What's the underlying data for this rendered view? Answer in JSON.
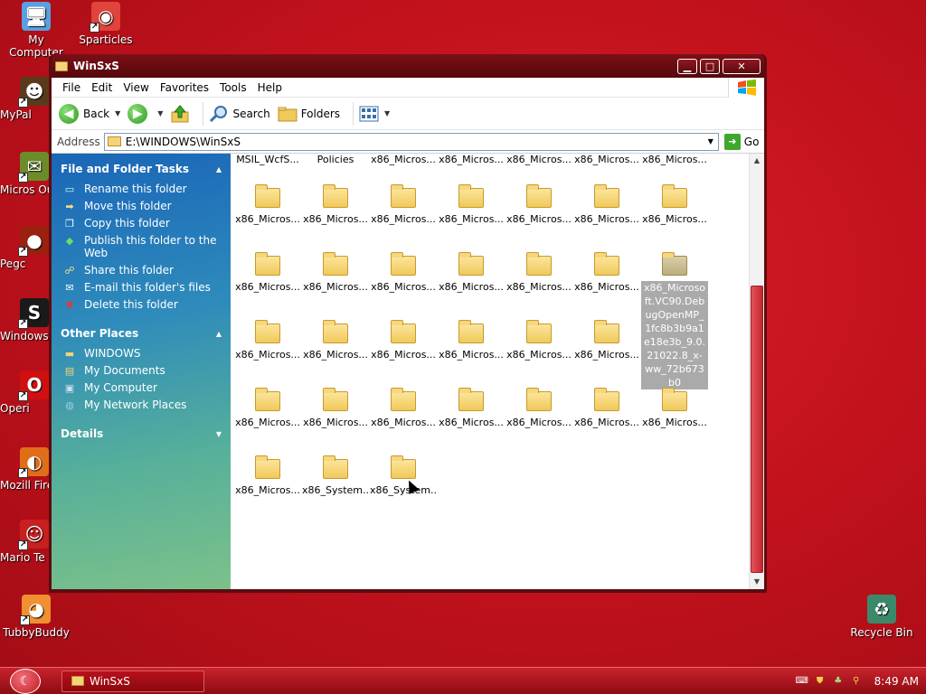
{
  "desktop": {
    "icons": [
      {
        "label": "My Computer",
        "glyph": "computer-icon",
        "color": "#5aa0e0"
      },
      {
        "label": "Sparticles",
        "glyph": "chrome-icon",
        "color": "#e0443a"
      },
      {
        "label": "MyPal",
        "glyph": "mypal-icon",
        "color": "#5b3a1c"
      },
      {
        "label": "Micros Outloo",
        "glyph": "outlook-icon",
        "color": "#6c8c2a"
      },
      {
        "label": "Pegc",
        "glyph": "pegasus-icon",
        "color": "#9a2010"
      },
      {
        "label": "Windows",
        "glyph": "windows-s-icon",
        "color": "#1a1a1a"
      },
      {
        "label": "Operi",
        "glyph": "opera-icon",
        "color": "#d01010"
      },
      {
        "label": "Mozill Firefo",
        "glyph": "firefox-icon",
        "color": "#e06e18"
      },
      {
        "label": "Mario Te",
        "glyph": "mario-icon",
        "color": "#c82020"
      },
      {
        "label": "TubbyBuddy",
        "glyph": "tubbybuddy-icon",
        "color": "#f09030"
      },
      {
        "label": "Recycle Bin",
        "glyph": "recycle-bin-icon",
        "color": "#3a8a6a"
      }
    ]
  },
  "window": {
    "title": "WinSxS",
    "controls": {
      "minimize": "▁",
      "maximize": "□",
      "close": "✕"
    }
  },
  "menu": {
    "items": [
      "File",
      "Edit",
      "View",
      "Favorites",
      "Tools",
      "Help"
    ]
  },
  "toolbar": {
    "back": "Back",
    "search": "Search",
    "folders": "Folders"
  },
  "address": {
    "label": "Address",
    "path": "E:\\WINDOWS\\WinSxS",
    "go": "Go"
  },
  "taskpane": {
    "file_tasks_title": "File and Folder Tasks",
    "file_tasks": [
      {
        "label": "Rename this folder",
        "icon": "rename-icon"
      },
      {
        "label": "Move this folder",
        "icon": "move-icon"
      },
      {
        "label": "Copy this folder",
        "icon": "copy-icon"
      },
      {
        "label": "Publish this folder to the Web",
        "icon": "publish-web-icon"
      },
      {
        "label": "Share this folder",
        "icon": "share-icon"
      },
      {
        "label": "E-mail this folder's files",
        "icon": "email-icon"
      },
      {
        "label": "Delete this folder",
        "icon": "delete-icon"
      }
    ],
    "other_places_title": "Other Places",
    "other_places": [
      {
        "label": "WINDOWS",
        "icon": "folder-icon"
      },
      {
        "label": "My Documents",
        "icon": "my-documents-icon"
      },
      {
        "label": "My Computer",
        "icon": "my-computer-icon"
      },
      {
        "label": "My Network Places",
        "icon": "network-places-icon"
      }
    ],
    "details_title": "Details"
  },
  "files": {
    "top_row": [
      "MSIL_WcfS...",
      "Policies",
      "x86_Micros...",
      "x86_Micros...",
      "x86_Micros...",
      "x86_Micros...",
      "x86_Micros..."
    ],
    "rows": [
      [
        "x86_Micros...",
        "x86_Micros...",
        "x86_Micros...",
        "x86_Micros...",
        "x86_Micros...",
        "x86_Micros...",
        "x86_Micros..."
      ],
      [
        "x86_Micros...",
        "x86_Micros...",
        "x86_Micros...",
        "x86_Micros...",
        "x86_Micros...",
        "x86_Micros...",
        "x86_Microsoft.VC90.DebugOpenMP_1fc8b3b9a1e18e3b_9.0.21022.8_x-ww_72b673b0"
      ],
      [
        "x86_Micros...",
        "x86_Micros...",
        "x86_Micros...",
        "x86_Micros...",
        "x86_Micros...",
        "x86_Micros..."
      ],
      [
        "x86_Micros...",
        "x86_Micros...",
        "x86_Micros...",
        "x86_Micros...",
        "x86_Micros...",
        "x86_Micros...",
        "x86_Micros..."
      ],
      [
        "x86_Micros...",
        "x86_System...",
        "x86_System..."
      ]
    ],
    "selected_row": 1,
    "selected_col": 6
  },
  "taskbar": {
    "task_label": "WinSxS",
    "clock": "8:49 AM"
  }
}
